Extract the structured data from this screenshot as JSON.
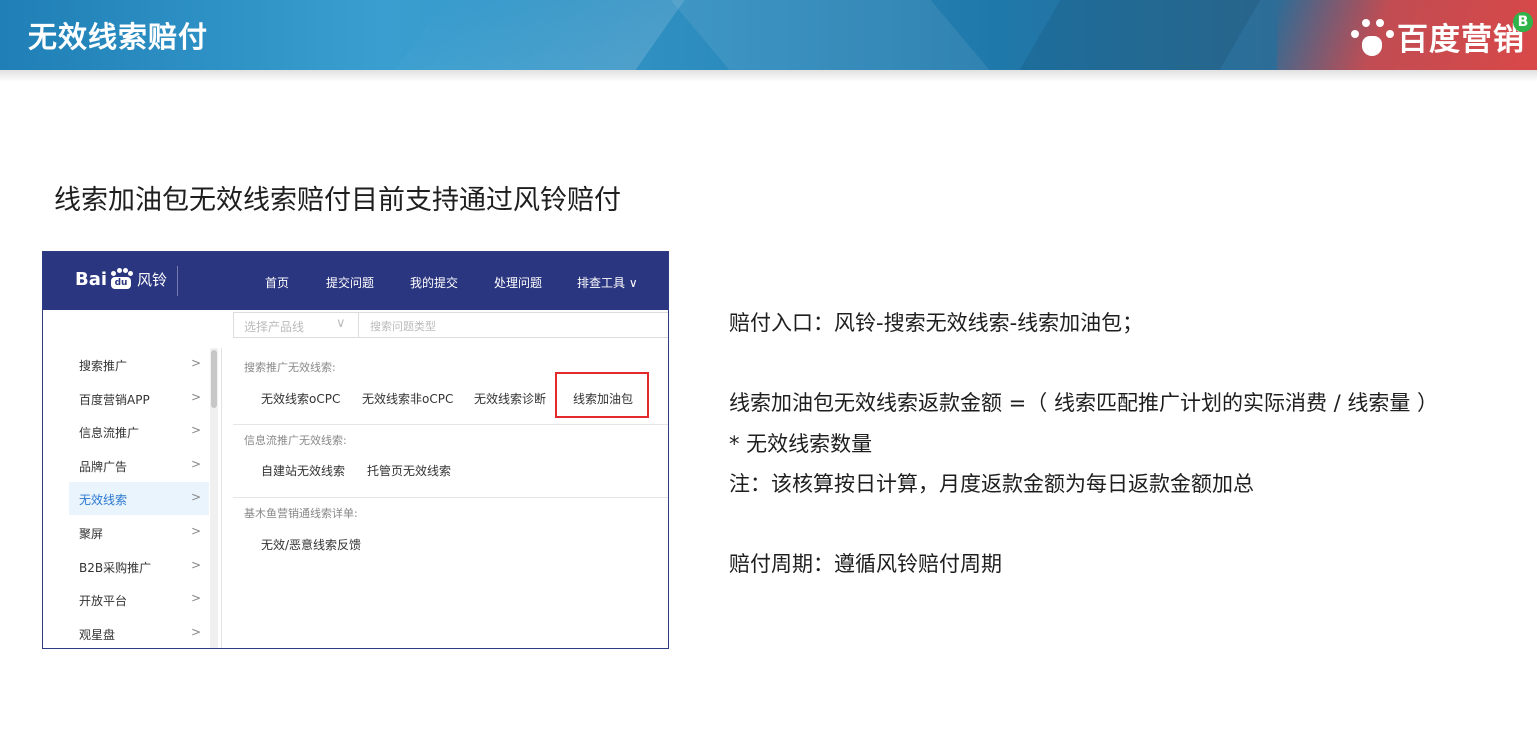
{
  "header": {
    "title": "无效线索赔付",
    "brand_text": "百度营销",
    "badge": "B",
    "colors": {
      "banner": "#2e8dbf",
      "accent_red": "#d94848"
    }
  },
  "heading": "线索加油包无效线索赔付目前支持通过风铃赔付",
  "screenshot": {
    "logo_bai": "Bai",
    "logo_du": "du",
    "logo_product": "风铃",
    "nav": [
      "首页",
      "提交问题",
      "我的提交",
      "处理问题",
      "排查工具 ∨"
    ],
    "filter": {
      "product_select": "选择产品线",
      "question_type": "搜索问题类型"
    },
    "sidebar": [
      {
        "label": "搜索推广",
        "active": false
      },
      {
        "label": "百度营销APP",
        "active": false
      },
      {
        "label": "信息流推广",
        "active": false
      },
      {
        "label": "品牌广告",
        "active": false
      },
      {
        "label": "无效线索",
        "active": true
      },
      {
        "label": "聚屏",
        "active": false
      },
      {
        "label": "B2B采购推广",
        "active": false
      },
      {
        "label": "开放平台",
        "active": false
      },
      {
        "label": "观星盘",
        "active": false
      }
    ],
    "sections": [
      {
        "title": "搜索推广无效线索:",
        "links": [
          "无效线索oCPC",
          "无效线索非oCPC",
          "无效线索诊断",
          "线索加油包"
        ]
      },
      {
        "title": "信息流推广无效线索:",
        "links": [
          "自建站无效线索",
          "托管页无效线索"
        ]
      },
      {
        "title": "基木鱼营销通线索详单:",
        "links": [
          "无效/恶意线索反馈"
        ]
      }
    ],
    "highlighted_link": "线索加油包"
  },
  "info": {
    "entry": "赔付入口：风铃-搜索无效线索-线索加油包；",
    "formula_line1": "线索加油包无效线索返款金额 =（  线索匹配推广计划的实际消费 / 线索量  ）",
    "formula_line2": "* 无效线索数量",
    "note": "注：该核算按日计算，月度返款金额为每日返款金额加总",
    "cycle": "赔付周期：遵循风铃赔付周期"
  }
}
